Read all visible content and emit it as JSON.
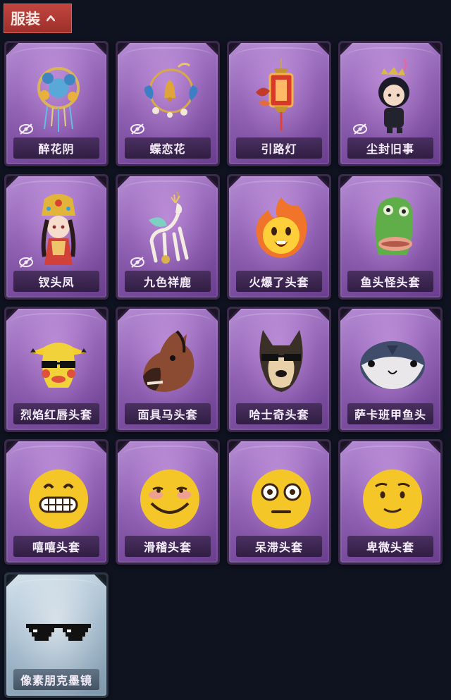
{
  "section": {
    "title": "服装"
  },
  "items": [
    {
      "label": "醉花阴",
      "icon": "floral-wreath-ornament-icon",
      "hidden": true
    },
    {
      "label": "蝶恋花",
      "icon": "butterfly-bell-wreath-icon",
      "hidden": true
    },
    {
      "label": "引路灯",
      "icon": "red-lantern-icon",
      "hidden": false
    },
    {
      "label": "尘封旧事",
      "icon": "chibi-doll-ornament-icon",
      "hidden": true
    },
    {
      "label": "钗头凤",
      "icon": "phoenix-crown-doll-icon",
      "hidden": true
    },
    {
      "label": "九色祥鹿",
      "icon": "deer-ornament-icon",
      "hidden": true
    },
    {
      "label": "火爆了头套",
      "icon": "fire-face-mask-icon",
      "hidden": false
    },
    {
      "label": "鱼头怪头套",
      "icon": "fish-head-mask-icon",
      "hidden": false
    },
    {
      "label": "烈焰红唇头套",
      "icon": "yellow-pikachu-mask-icon",
      "hidden": false
    },
    {
      "label": "面具马头套",
      "icon": "horse-head-mask-icon",
      "hidden": false
    },
    {
      "label": "哈士奇头套",
      "icon": "husky-mask-icon",
      "hidden": false
    },
    {
      "label": "萨卡班甲鱼头",
      "icon": "sacabambaspis-mask-icon",
      "hidden": false
    },
    {
      "label": "嘻嘻头套",
      "icon": "grin-emoji-mask-icon",
      "hidden": false
    },
    {
      "label": "滑稽头套",
      "icon": "funny-emoji-mask-icon",
      "hidden": false
    },
    {
      "label": "呆滞头套",
      "icon": "dazed-emoji-mask-icon",
      "hidden": false
    },
    {
      "label": "卑微头套",
      "icon": "humble-emoji-mask-icon",
      "hidden": false
    },
    {
      "label": "像素朋克墨镜",
      "icon": "pixel-sunglasses-icon",
      "hidden": false
    }
  ],
  "colors": {
    "header_red": "#b23a35",
    "card_purple": "#8d5fb1",
    "card_glass": "#9fb6c8",
    "background": "#0f1320"
  }
}
